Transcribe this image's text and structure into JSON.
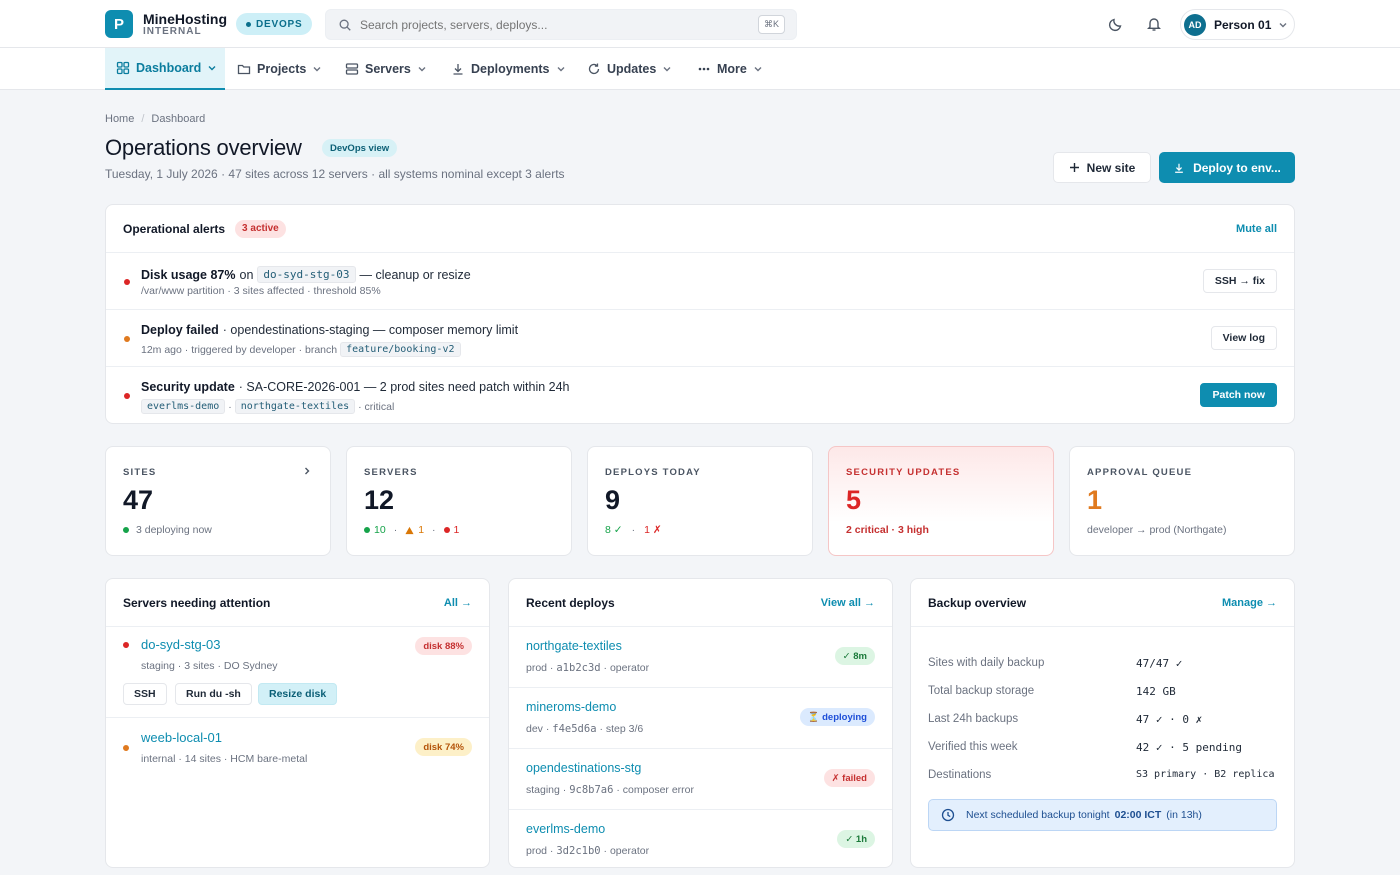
{
  "brand": {
    "logo_letter": "P",
    "name": "MineHosting",
    "sub": "INTERNAL",
    "env": "DEVOPS"
  },
  "search": {
    "placeholder": "Search projects, servers, deploys...",
    "shortcut": "⌘K"
  },
  "user": {
    "initials": "AD",
    "name": "Person 01"
  },
  "nav": [
    {
      "label": "Dashboard",
      "icon": "grid-icon",
      "active": true
    },
    {
      "label": "Projects",
      "icon": "folder-icon"
    },
    {
      "label": "Servers",
      "icon": "server-icon"
    },
    {
      "label": "Deployments",
      "icon": "download-icon"
    },
    {
      "label": "Updates",
      "icon": "refresh-icon"
    },
    {
      "label": "More",
      "icon": "dots-icon"
    }
  ],
  "breadcrumb": {
    "home": "Home",
    "sep": "/",
    "current": "Dashboard"
  },
  "header": {
    "title": "Operations overview",
    "badge": "DevOps view",
    "subtitle": "Tuesday, 1 July 2026 · 47 sites across 12 servers · all systems nominal except 3 alerts",
    "new_site": "New site",
    "deploy": "Deploy to env..."
  },
  "alerts": {
    "title": "Operational alerts",
    "badge": "3 active",
    "action": "Mute all",
    "items": [
      {
        "strong": "Disk usage 87%",
        "pre": "on",
        "code": "do-syd-stg-03",
        "post": "— cleanup or resize",
        "sub": "/var/www partition · 3 sites affected · threshold 85%",
        "button": "SSH → fix",
        "color": "#dc2626"
      },
      {
        "strong": "Deploy failed",
        "post": "· opendestinations-staging — composer memory limit",
        "sub_pre": "12m ago · triggered by developer · branch",
        "sub_code": "feature/booking-v2",
        "button": "View log",
        "color": "#e07a1f"
      },
      {
        "strong": "Security update",
        "post": "· SA-CORE-2026-001 — 2 prod sites need patch within 24h",
        "sub_code1": "everlms-demo",
        "sub_sep": "·",
        "sub_code2": "northgate-textiles",
        "sub_post": "· critical",
        "button": "Patch now",
        "color": "#dc2626"
      }
    ]
  },
  "stats": [
    {
      "label": "SITES",
      "value": "47",
      "foot": "3 deploying now"
    },
    {
      "label": "SERVERS",
      "value": "12",
      "foot_a": "10",
      "foot_sep": "·",
      "foot_b": "1",
      "foot_c": "1"
    },
    {
      "label": "DEPLOYS TODAY",
      "value": "9",
      "foot_a": "8 ✓",
      "foot_sep": "·",
      "foot_b": "1 ✗"
    },
    {
      "label": "SECURITY UPDATES",
      "value": "5",
      "foot": "2 critical · 3 high"
    },
    {
      "label": "APPROVAL QUEUE",
      "value": "1",
      "foot": "developer → prod (Northgate)"
    }
  ],
  "servers": {
    "title": "Servers needing attention",
    "link": "All →",
    "items": [
      {
        "name": "do-syd-stg-03",
        "meta": "staging · 3 sites · DO Sydney",
        "pill": "disk 88%",
        "buttons": [
          "SSH",
          "Run du -sh",
          "Resize disk"
        ]
      },
      {
        "name": "weeb-local-01",
        "meta": "internal · 14 sites · HCM bare-metal",
        "pill": "disk 74%"
      }
    ]
  },
  "deploys": {
    "title": "Recent deploys",
    "link": "View all →",
    "items": [
      {
        "name": "northgate-textiles",
        "meta_pre": "prod ·",
        "hash": "a1b2c3d",
        "meta_post": "· operator",
        "pill": "✓ 8m"
      },
      {
        "name": "mineroms-demo",
        "meta_pre": "dev ·",
        "hash": "f4e5d6a",
        "meta_post": "· step 3/6",
        "pill": "⏳ deploying"
      },
      {
        "name": "opendestinations-stg",
        "meta_pre": "staging ·",
        "hash": "9c8b7a6",
        "meta_post": "· composer error",
        "pill": "✗ failed"
      },
      {
        "name": "everlms-demo",
        "meta_pre": "prod ·",
        "hash": "3d2c1b0",
        "meta_post": "· operator",
        "pill": "✓ 1h"
      }
    ]
  },
  "backup": {
    "title": "Backup overview",
    "link": "Manage →",
    "rows": [
      {
        "label": "Sites with daily backup",
        "value": "47/47 ✓"
      },
      {
        "label": "Total backup storage",
        "value": "142 GB"
      },
      {
        "label": "Last 24h backups",
        "value": "47 ✓ · 0 ✗"
      },
      {
        "label": "Verified this week",
        "value": "42 ✓ · 5 pending"
      },
      {
        "label": "Destinations",
        "value": "S3 primary · B2 replica"
      }
    ],
    "note_pre": "Next scheduled backup tonight",
    "note_time": "02:00 ICT",
    "note_post": "(in 13h)"
  },
  "colors": {
    "accent": "#0e8db0",
    "danger": "#dc2626",
    "warning": "#e07a1f",
    "success": "#16a34a"
  }
}
